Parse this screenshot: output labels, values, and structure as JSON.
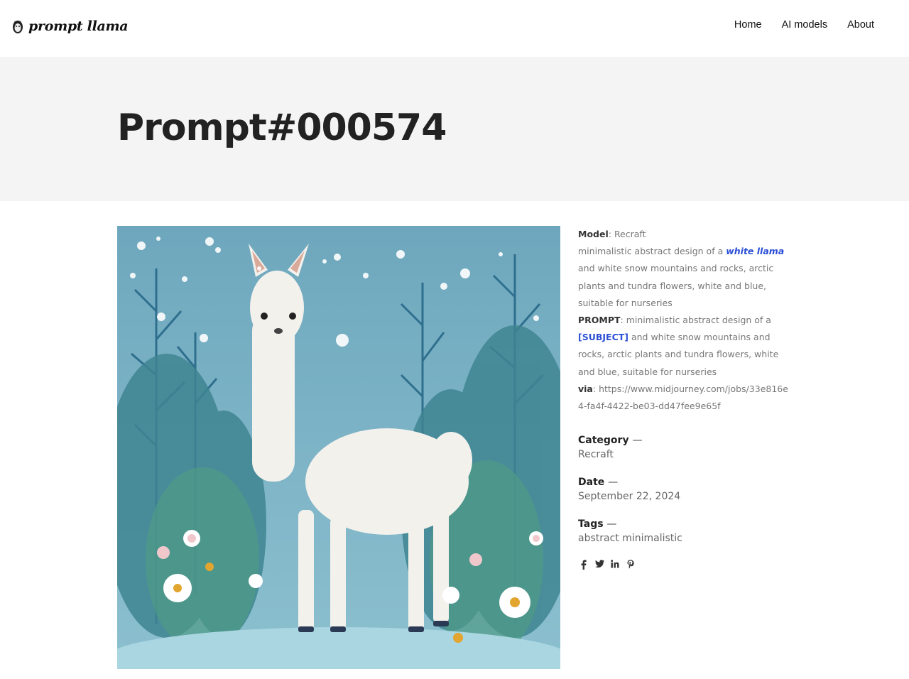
{
  "header": {
    "logo_text": "prompt llama",
    "nav": [
      {
        "label": "Home"
      },
      {
        "label": "AI models"
      },
      {
        "label": "About"
      }
    ]
  },
  "hero": {
    "title": "Prompt#000574"
  },
  "details": {
    "model_label": "Model",
    "model_value": "Recraft",
    "description_pre": "minimalistic abstract design of a ",
    "description_subject": "white llama",
    "description_post": " and white snow mountains and rocks, arctic plants and tundra flowers, white and blue, suitable for nurseries",
    "prompt_label": "PROMPT",
    "prompt_pre": "minimalistic abstract design of a ",
    "prompt_subject": "[SUBJECT]",
    "prompt_post": " and white snow mountains and rocks, arctic plants and tundra flowers, white and blue, suitable for nurseries",
    "via_label": "via",
    "via_value": "https://www.midjourney.com/jobs/33e816e4-fa4f-4422-be03-dd47fee9e65f"
  },
  "meta": {
    "category_label": "Category",
    "category_value": "Recraft",
    "date_label": "Date",
    "date_value": "September 22, 2024",
    "tags_label": "Tags",
    "tags_value": "abstract minimalistic",
    "dash": "—"
  },
  "share_icons": [
    "facebook-icon",
    "twitter-icon",
    "linkedin-icon",
    "pinterest-icon"
  ],
  "colors": {
    "accent": "#2b4fd6",
    "hero_bg": "#f4f4f4",
    "art_sky": "#6fa9bf"
  }
}
